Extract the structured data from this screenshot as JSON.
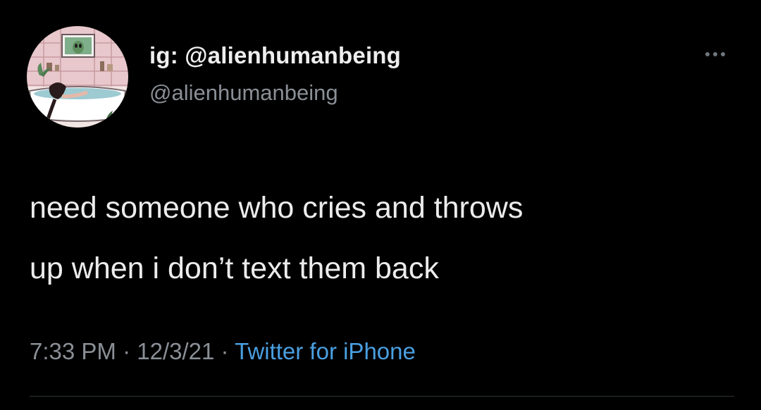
{
  "tweet": {
    "display_name": "ig: @alienhumanbeing",
    "handle": "@alienhumanbeing",
    "more_icon": "more-horizontal-icon",
    "text_lines": [
      "need someone who cries and throws",
      "up when i don’t text them back"
    ],
    "time": "7:33 PM",
    "separator": " · ",
    "date": "12/3/21",
    "source": "Twitter for iPhone"
  },
  "colors": {
    "background": "#000000",
    "text": "#ececec",
    "secondary_text": "#8a8f96",
    "link": "#4a9fe0"
  }
}
